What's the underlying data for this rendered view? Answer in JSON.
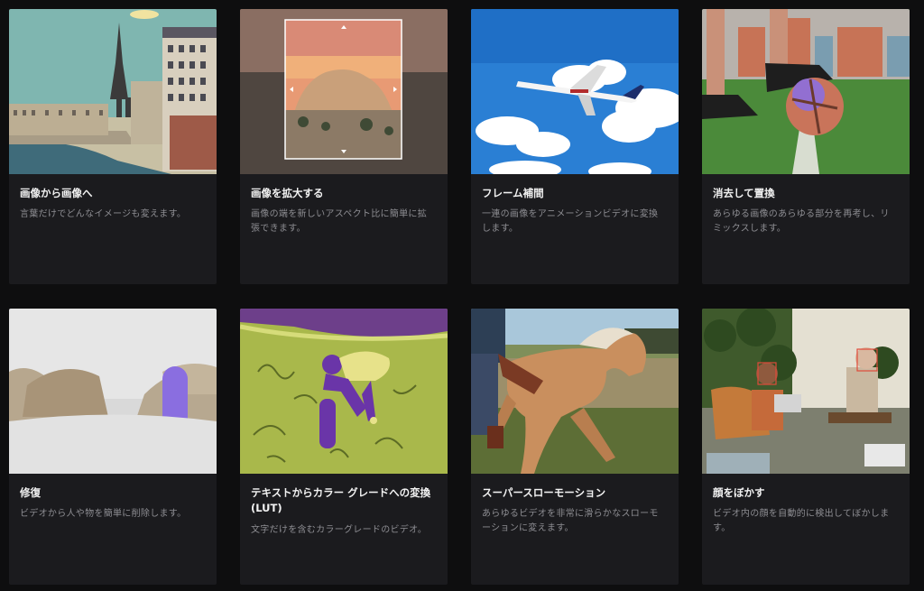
{
  "cards": [
    {
      "title": "画像から画像へ",
      "desc": "言葉だけでどんなイメージも変えます。"
    },
    {
      "title": "画像を拡大する",
      "desc": "画像の端を新しいアスペクト比に簡単に拡張できます。"
    },
    {
      "title": "フレーム補間",
      "desc": "一連の画像をアニメーションビデオに変換します。"
    },
    {
      "title": "消去して置換",
      "desc": "あらゆる画像のあらゆる部分を再考し、リミックスします。"
    },
    {
      "title": "修復",
      "desc": "ビデオから人や物を簡単に削除します。"
    },
    {
      "title": "テキストからカラー グレードへの変換 (LUT)",
      "desc": "文字だけを含むカラーグレードのビデオ。"
    },
    {
      "title": "スーパースローモーション",
      "desc": "あらゆるビデオを非常に滑らかなスローモーションに変えます。"
    },
    {
      "title": "顔をぼかす",
      "desc": "ビデオ内の顔を自動的に検出してぼかします。"
    }
  ]
}
